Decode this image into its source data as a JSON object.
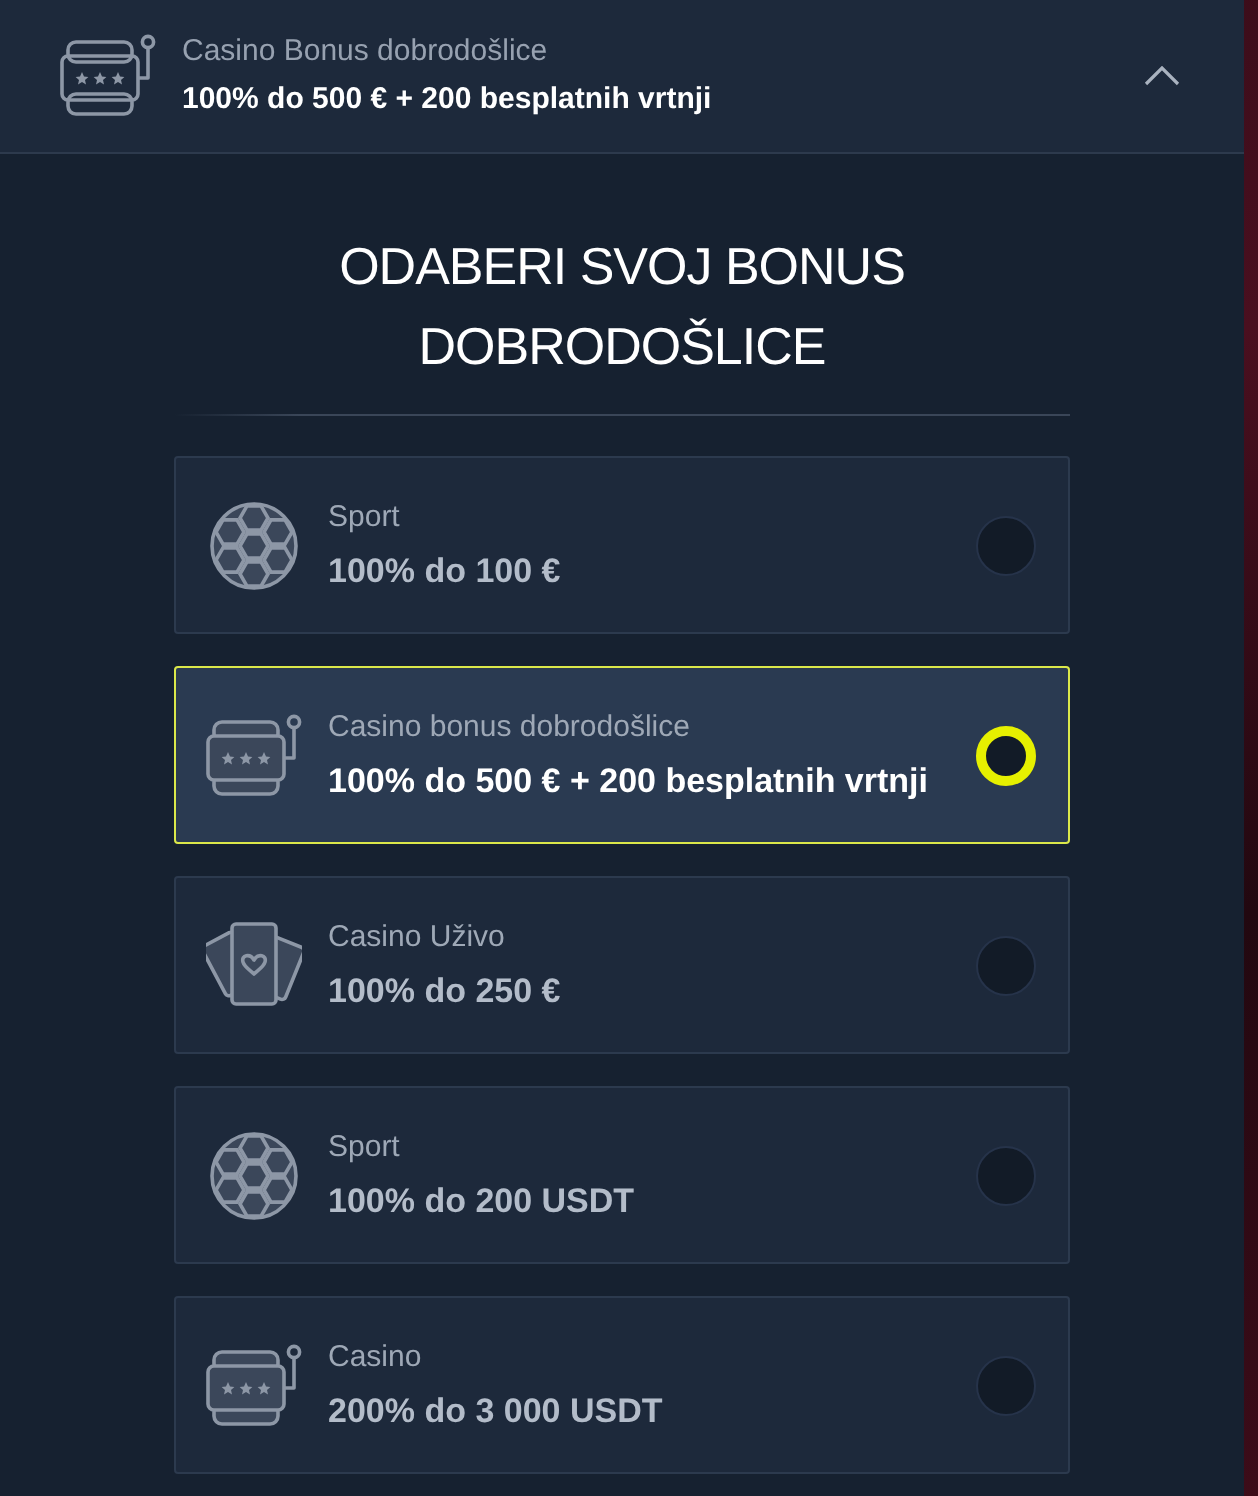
{
  "header": {
    "title": "Casino Bonus dobrodošlice",
    "subtitle": "100% do 500 € + 200 besplatnih vrtnji",
    "kind": "slot",
    "expanded": true
  },
  "heading": "ODABERI SVOJ BONUS DOBRODOŠLICE",
  "bonuses": [
    {
      "kind": "sport",
      "title": "Sport",
      "amount": "100% do 100 €",
      "selected": false
    },
    {
      "kind": "slot",
      "title": "Casino bonus dobrodošlice",
      "amount": "100% do 500 € + 200 besplatnih vrtnji",
      "selected": true
    },
    {
      "kind": "cards",
      "title": "Casino Uživo",
      "amount": "100% do 250 €",
      "selected": false
    },
    {
      "kind": "sport",
      "title": "Sport",
      "amount": "100% do 200 USDT",
      "selected": false
    },
    {
      "kind": "slot",
      "title": "Casino",
      "amount": "200% do 3 000 USDT",
      "selected": false
    }
  ]
}
